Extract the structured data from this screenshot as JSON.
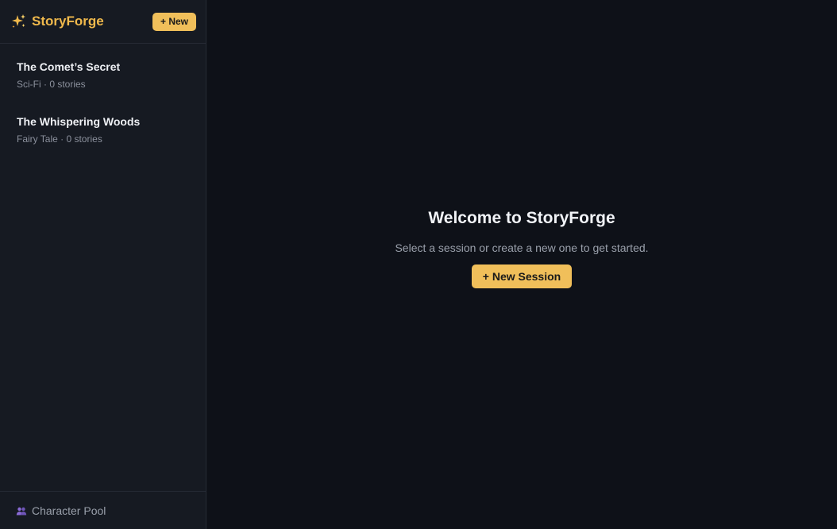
{
  "sidebar": {
    "brand": {
      "icon": "sparkles-icon",
      "name": "StoryForge"
    },
    "new_button": "+ New",
    "sessions": [
      {
        "title": "The Comet’s Secret",
        "meta": "Sci-Fi · 0 stories"
      },
      {
        "title": "The Whispering Woods",
        "meta": "Fairy Tale · 0 stories"
      }
    ],
    "footer": {
      "icon": "people-icon",
      "label": "Character Pool"
    }
  },
  "main": {
    "title": "Welcome to StoryForge",
    "subtitle": "Select a session or create a new one to get started.",
    "new_session_button": "+ New Session"
  },
  "colors": {
    "accent": "#f0bf5a",
    "brand_text": "#f0b94c",
    "sidebar_bg": "#161a22",
    "main_bg": "#0e1118"
  }
}
